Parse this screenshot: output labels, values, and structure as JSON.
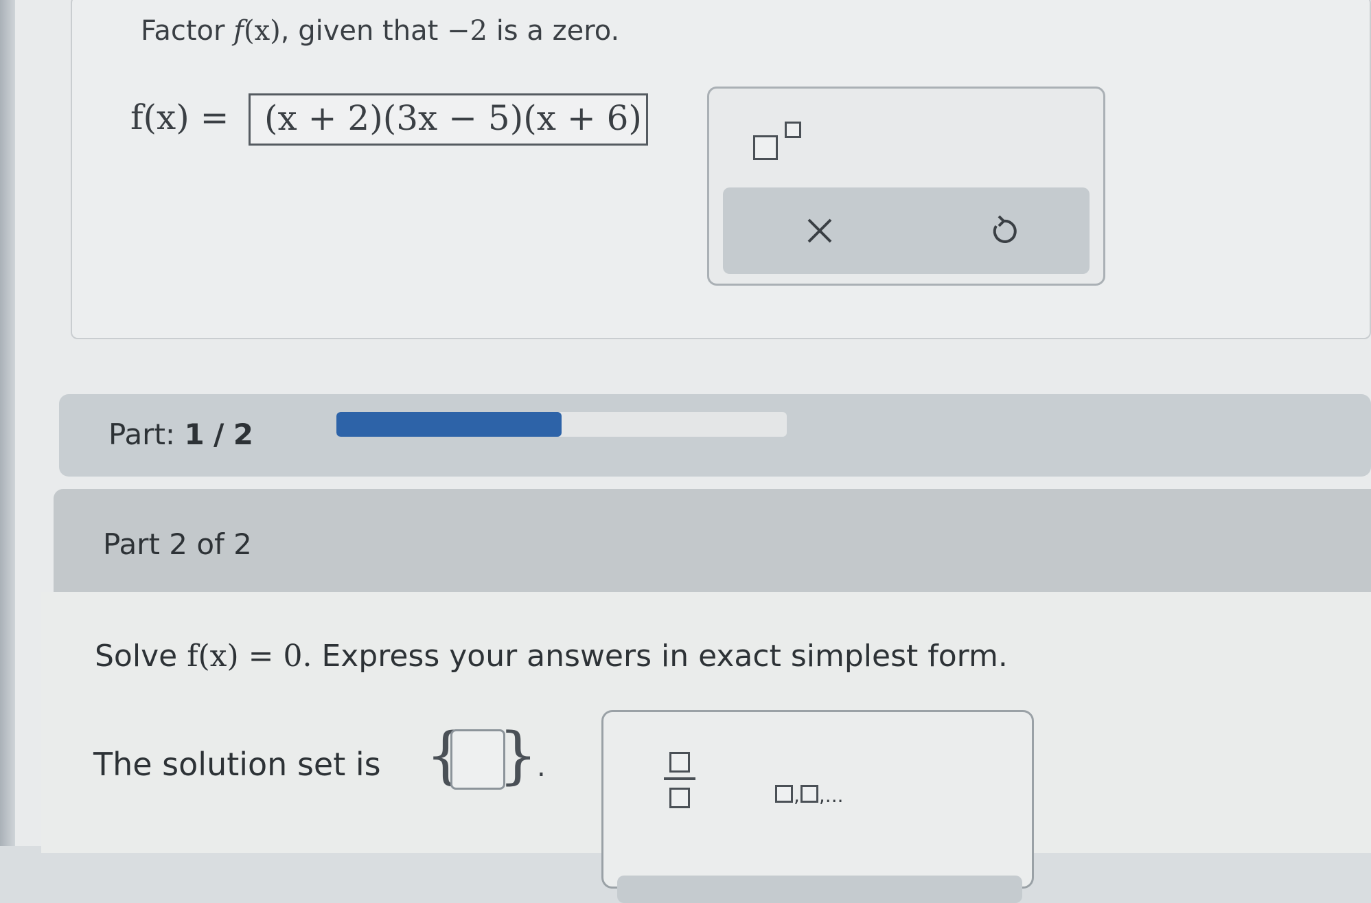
{
  "part1": {
    "question_prefix": "Factor",
    "question_fn": "f",
    "question_arg": "(x)",
    "question_mid": ", given that",
    "question_zero": "−2",
    "question_suffix": "is a zero.",
    "fx_label": "f(x) =",
    "answer_value": "(x + 2)(3x − 5)(x + 6)"
  },
  "tools1": {
    "exponent_tool_icon": "superscript-template-icon",
    "clear_icon": "x-icon",
    "undo_icon": "undo-icon"
  },
  "progress": {
    "label": "Part:",
    "current": "1",
    "separator": "/",
    "total": "2",
    "fraction": 0.5,
    "fill_color": "#2d63a8"
  },
  "part2": {
    "title": "Part 2 of 2",
    "solve_prefix": "Solve",
    "solve_equation": "f(x) = 0.",
    "solve_suffix": "Express your answers in exact simplest form.",
    "solution_label": "The solution set is",
    "period": "."
  },
  "tools2": {
    "fraction_tool_icon": "fraction-template-icon",
    "list_tool_icon": "list-template-icon",
    "list_ellipsis": ",..."
  }
}
